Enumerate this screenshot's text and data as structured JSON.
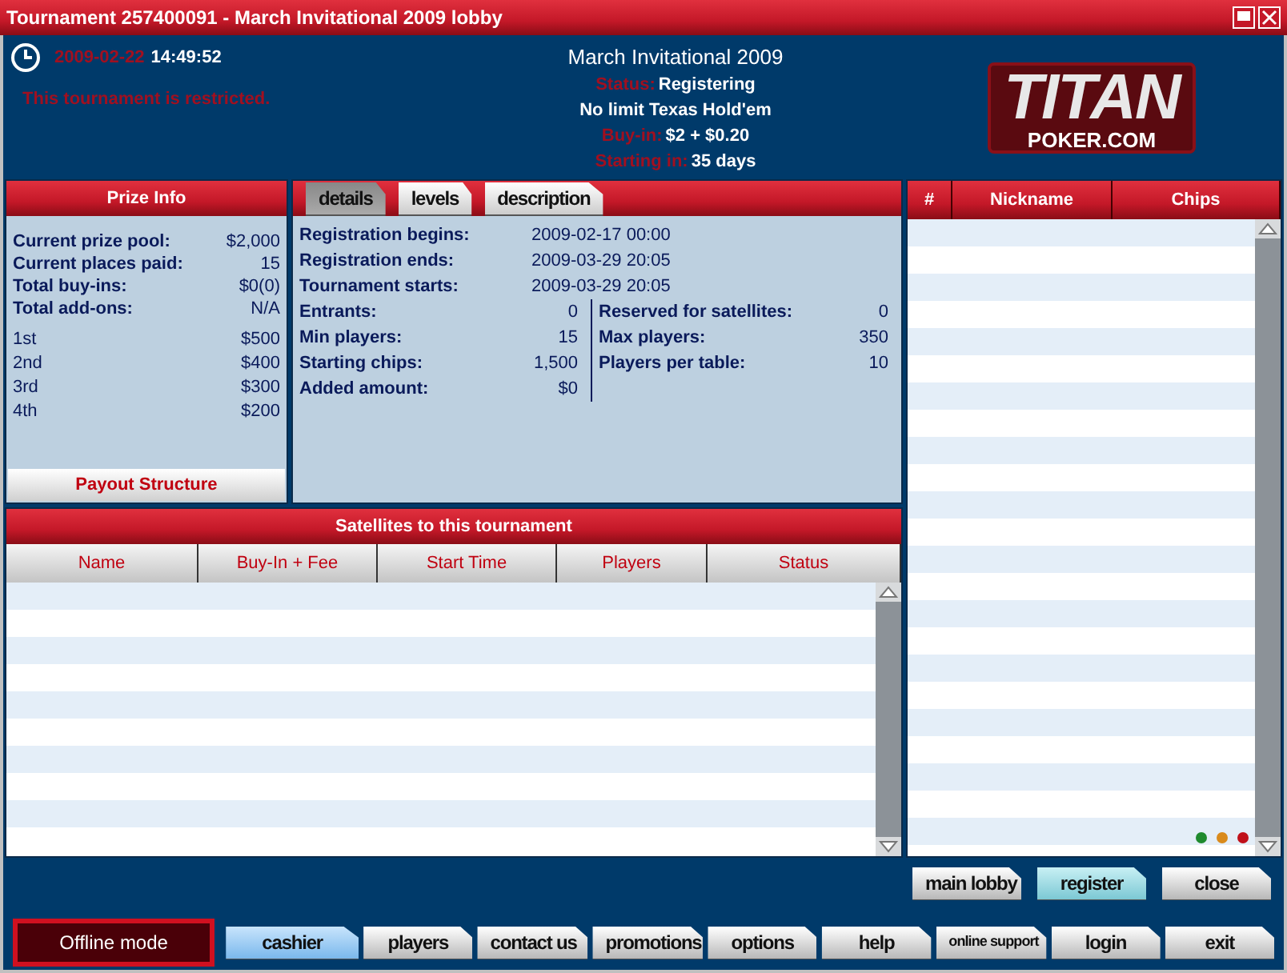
{
  "window": {
    "title": "Tournament 257400091 - March Invitational 2009 lobby"
  },
  "header": {
    "date": "2009-02-22",
    "time": "14:49:52",
    "notice": "This tournament is restricted.",
    "name": "March Invitational 2009",
    "fields": [
      {
        "label": "Status:",
        "value": "Registering"
      },
      {
        "value": "No limit Texas Hold'em"
      },
      {
        "label": "Buy-in:",
        "value": "$2 + $0.20"
      },
      {
        "label": "Starting in:",
        "value": "35 days"
      }
    ],
    "logo": {
      "main": "TITAN",
      "sub": "POKER.COM"
    }
  },
  "prize_info": {
    "title": "Prize Info",
    "summary": [
      {
        "label": "Current prize pool:",
        "value": "$2,000"
      },
      {
        "label": "Current places paid:",
        "value": "15"
      },
      {
        "label": "Total buy-ins:",
        "value": "$0(0)"
      },
      {
        "label": "Total add-ons:",
        "value": "N/A"
      }
    ],
    "places": [
      {
        "place": "1st",
        "prize": "$500"
      },
      {
        "place": "2nd",
        "prize": "$400"
      },
      {
        "place": "3rd",
        "prize": "$300"
      },
      {
        "place": "4th",
        "prize": "$200"
      }
    ],
    "button": "Payout Structure"
  },
  "tabs": [
    {
      "label": "details",
      "selected": true
    },
    {
      "label": "levels",
      "selected": false
    },
    {
      "label": "description",
      "selected": false
    }
  ],
  "details": {
    "dates": [
      {
        "label": "Registration begins:",
        "value": "2009-02-17 00:00"
      },
      {
        "label": "Registration ends:",
        "value": "2009-03-29 20:05"
      },
      {
        "label": "Tournament starts:",
        "value": "2009-03-29 20:05"
      }
    ],
    "left": [
      {
        "label": "Entrants:",
        "value": "0"
      },
      {
        "label": "Min players:",
        "value": "15"
      },
      {
        "label": "Starting chips:",
        "value": "1,500"
      },
      {
        "label": "Added amount:",
        "value": "$0"
      }
    ],
    "right": [
      {
        "label": "Reserved for satellites:",
        "value": "0"
      },
      {
        "label": "Max players:",
        "value": "350"
      },
      {
        "label": "Players per table:",
        "value": "10"
      }
    ]
  },
  "satellites": {
    "title": "Satellites to this tournament",
    "columns": [
      "Name",
      "Buy-In + Fee",
      "Start Time",
      "Players",
      "Status"
    ]
  },
  "players": {
    "columns": [
      "#",
      "Nickname",
      "Chips"
    ],
    "legend": [
      {
        "color": "#1f8a2e"
      },
      {
        "color": "#d98a1c"
      },
      {
        "color": "#c0101a"
      }
    ]
  },
  "actions": [
    {
      "label": "main lobby",
      "highlighted": false
    },
    {
      "label": "register",
      "highlighted": true
    },
    {
      "label": "close",
      "highlighted": false
    }
  ],
  "status": {
    "label": "Offline mode"
  },
  "nav": [
    {
      "label": "cashier",
      "selected": true
    },
    {
      "label": "players",
      "selected": false
    },
    {
      "label": "contact us",
      "selected": false
    },
    {
      "label": "promotions",
      "selected": false
    },
    {
      "label": "options",
      "selected": false
    },
    {
      "label": "help",
      "selected": false
    },
    {
      "label": "online support",
      "selected": false,
      "small": true
    },
    {
      "label": "login",
      "selected": false
    },
    {
      "label": "exit",
      "selected": false
    }
  ]
}
